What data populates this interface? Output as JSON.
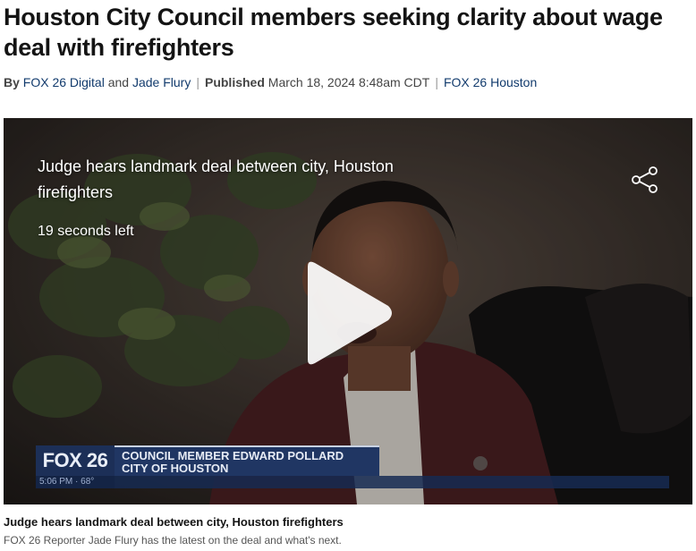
{
  "article": {
    "headline": "Houston City Council members seeking clarity about wage deal with firefighters",
    "byline": {
      "by_label": "By",
      "author1": "FOX 26 Digital",
      "and_label": "and",
      "author2": "Jade Flury",
      "published_label": "Published",
      "date": "March 18, 2024 8:48am CDT",
      "source": "FOX 26 Houston"
    }
  },
  "video": {
    "title": "Judge hears landmark deal between city, Houston firefighters",
    "time_left": "19 seconds left",
    "lower_third": {
      "logo": "FOX 26",
      "name": "COUNCIL MEMBER EDWARD POLLARD",
      "affiliation": "CITY OF HOUSTON",
      "time_temp": "5:06 PM · 68°"
    },
    "icons": {
      "share": "share-icon",
      "play": "play-icon"
    }
  },
  "caption": {
    "title": "Judge hears landmark deal between city, Houston firefighters",
    "text": "FOX 26 Reporter Jade Flury has the latest on the deal and what's next."
  },
  "colors": {
    "link": "#123b6d",
    "fox_blue": "#203663"
  }
}
